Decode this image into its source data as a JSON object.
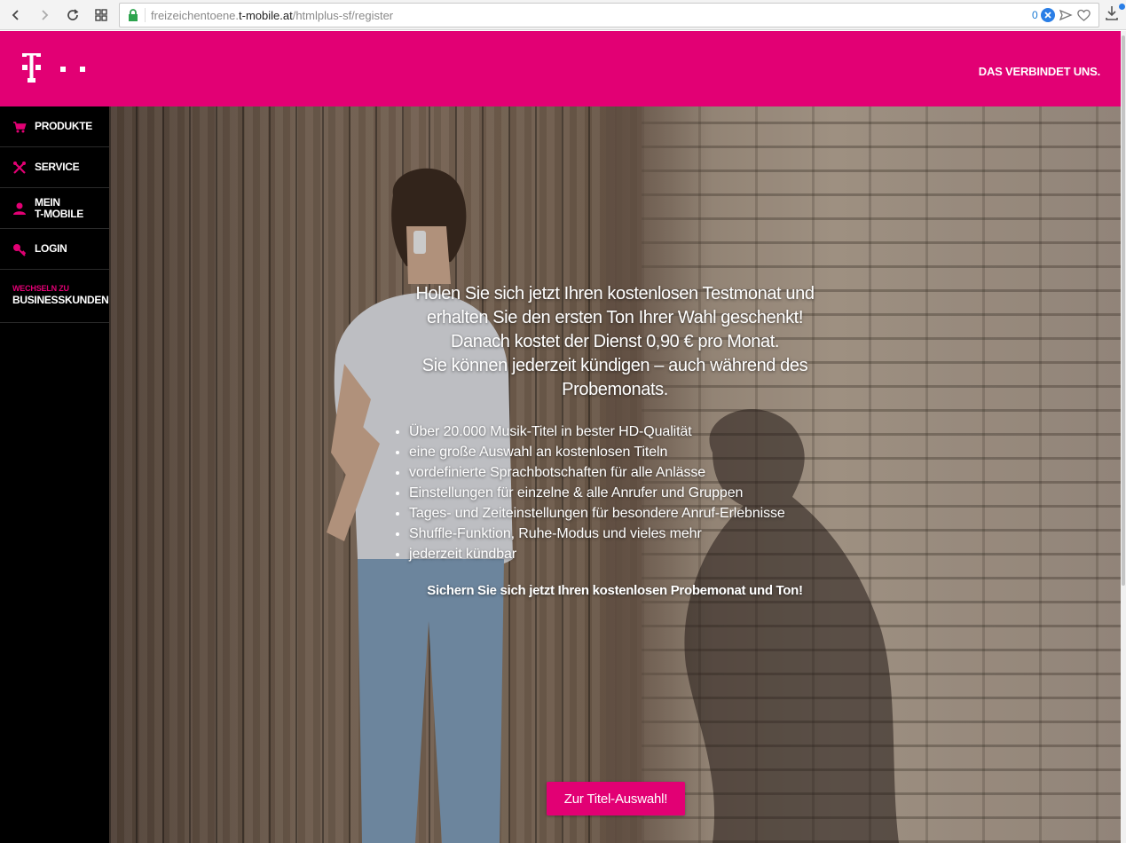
{
  "browser": {
    "url_prefix": "freizeichentoene.",
    "url_domain": "t-mobile.at",
    "url_path": "/htmlplus-sf/register",
    "tab_count": "0"
  },
  "header": {
    "tagline": "DAS VERBINDET UNS."
  },
  "sidebar": {
    "items": [
      {
        "label": "PRODUKTE",
        "icon": "cart-icon"
      },
      {
        "label": "SERVICE",
        "icon": "tools-icon"
      },
      {
        "label": "MEIN\nT-MOBILE",
        "icon": "user-icon"
      },
      {
        "label": "LOGIN",
        "icon": "key-icon"
      }
    ],
    "business_small": "WECHSELN ZU",
    "business_big": "BUSINESSKUNDEN"
  },
  "hero": {
    "headline": [
      "Holen Sie sich jetzt Ihren kostenlosen Testmonat und",
      "erhalten Sie den ersten Ton Ihrer Wahl geschenkt!",
      "Danach kostet der Dienst 0,90 € pro Monat.",
      "Sie können jederzeit kündigen – auch während des",
      "Probemonats."
    ],
    "features": [
      "Über 20.000 Musik-Titel in bester HD-Qualität",
      "eine große Auswahl an kostenlosen Titeln",
      "vordefinierte Sprachbotschaften für alle Anlässe",
      "Einstellungen für einzelne & alle Anrufer und Gruppen",
      "Tages- und Zeiteinstellungen für besondere Anruf-Erlebnisse",
      "Shuffle-Funktion, Ruhe-Modus und vieles mehr",
      "jederzeit kündbar"
    ],
    "closing": "Sichern Sie sich jetzt Ihren kostenlosen Probemonat und Ton!",
    "cta_label": "Zur Titel-Auswahl!"
  },
  "colors": {
    "brand_magenta": "#e20074",
    "sidebar_bg": "#000000"
  }
}
